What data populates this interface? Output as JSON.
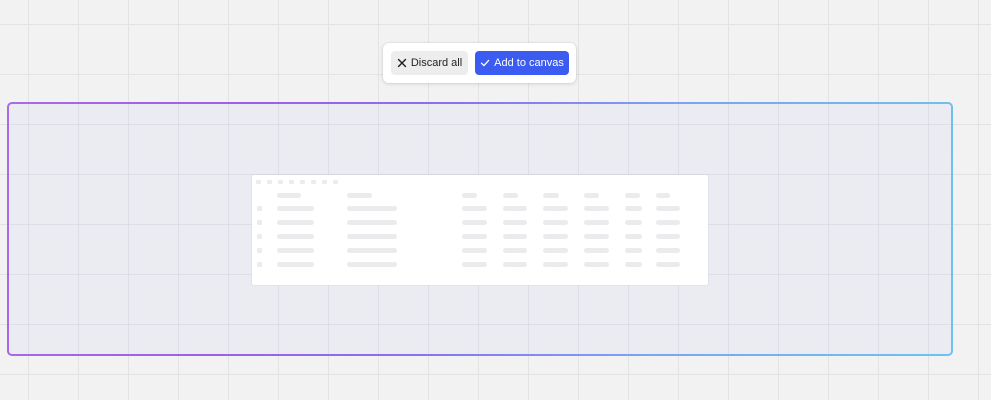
{
  "toolbar": {
    "discard_label": "Discard all",
    "add_label": "Add to canvas",
    "discard_icon": "close-icon",
    "add_icon": "check-icon"
  },
  "colors": {
    "canvas_background": "#f2f2f2",
    "primary_button": "#3c5bf0",
    "secondary_button": "#ededed",
    "frame_gradient_start": "#a86ae6",
    "frame_gradient_end": "#6cc3f0"
  },
  "table_preview": {
    "state": "loading-skeleton"
  }
}
